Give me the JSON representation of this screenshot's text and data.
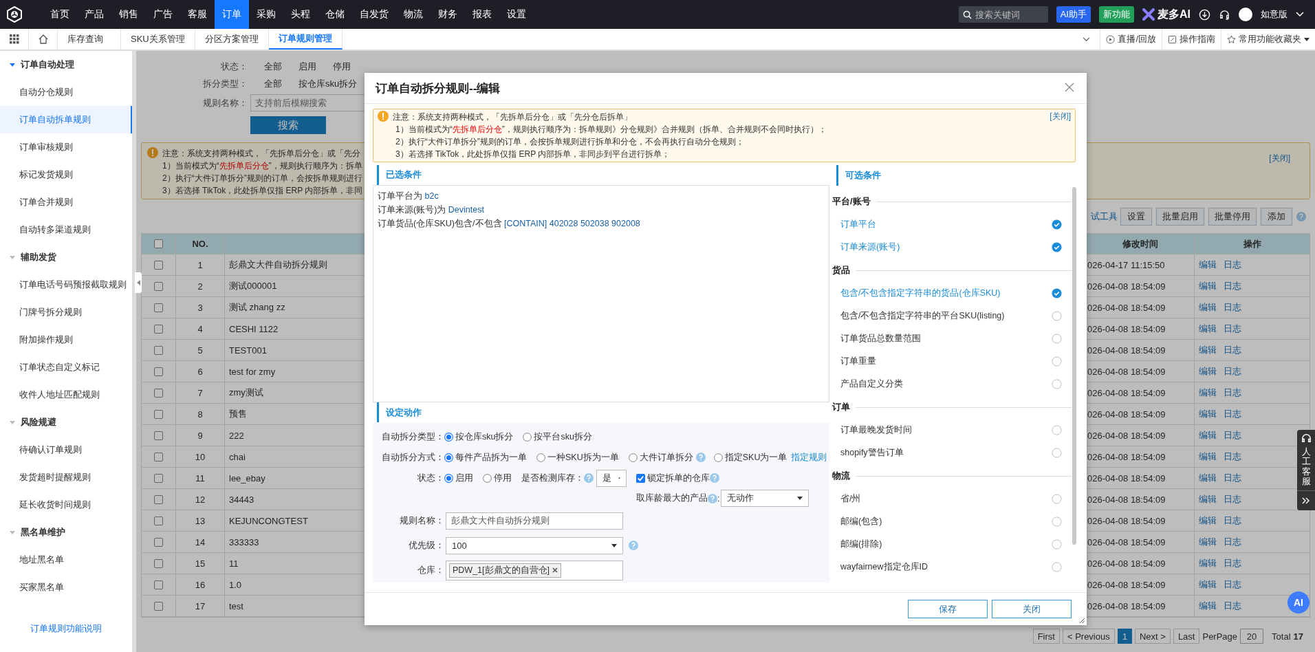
{
  "top_nav": {
    "menu": [
      {
        "label": "首页",
        "selected": false
      },
      {
        "label": "产品",
        "selected": false
      },
      {
        "label": "销售",
        "selected": false
      },
      {
        "label": "广告",
        "selected": false
      },
      {
        "label": "客服",
        "selected": false
      },
      {
        "label": "订单",
        "selected": true
      },
      {
        "label": "采购",
        "selected": false
      },
      {
        "label": "头程",
        "selected": false
      },
      {
        "label": "仓储",
        "selected": false
      },
      {
        "label": "自发货",
        "selected": false
      },
      {
        "label": "物流",
        "selected": false
      },
      {
        "label": "财务",
        "selected": false
      },
      {
        "label": "报表",
        "selected": false
      },
      {
        "label": "设置",
        "selected": false
      }
    ],
    "search": {
      "placeholder": "搜索关键词"
    },
    "ai_button": "AI助手",
    "new_button": "新功能",
    "brand": "麦多AI",
    "edition": "如意版"
  },
  "tab_bar": {
    "tabs": [
      {
        "label": "库存查询",
        "selected": false
      },
      {
        "label": "SKU关系管理",
        "selected": false
      },
      {
        "label": "分区方案管理",
        "selected": false
      },
      {
        "label": "订单规则管理",
        "selected": true
      }
    ],
    "links": [
      {
        "label": "直播/回放",
        "kind": "play"
      },
      {
        "label": "操作指南",
        "kind": "guide"
      },
      {
        "label": "常用功能收藏夹",
        "kind": "star"
      }
    ]
  },
  "sidebar": {
    "groups": [
      {
        "title": "订单自动处理",
        "items": [
          {
            "label": "自动分仓规则",
            "selected": false
          },
          {
            "label": "订单自动拆单规则",
            "selected": true
          },
          {
            "label": "订单审核规则",
            "selected": false
          },
          {
            "label": "标记发货规则",
            "selected": false
          },
          {
            "label": "订单合并规则",
            "selected": false
          },
          {
            "label": "自动转多渠道规则",
            "selected": false
          }
        ]
      },
      {
        "title": "辅助发货",
        "items": [
          {
            "label": "订单电话号码预报截取规则",
            "selected": false
          },
          {
            "label": "门牌号拆分规则",
            "selected": false
          },
          {
            "label": "附加操作规则",
            "selected": false
          },
          {
            "label": "订单状态自定义标记",
            "selected": false
          },
          {
            "label": "收件人地址匹配规则",
            "selected": false
          }
        ]
      },
      {
        "title": "风险规避",
        "items": [
          {
            "label": "待确认订单规则",
            "selected": false
          },
          {
            "label": "发货超时提醒规则",
            "selected": false
          },
          {
            "label": "延长收货时间规则",
            "selected": false
          }
        ]
      },
      {
        "title": "黑名单维护",
        "items": [
          {
            "label": "地址黑名单",
            "selected": false
          },
          {
            "label": "买家黑名单",
            "selected": false
          }
        ]
      }
    ],
    "footer_link": "订单规则功能说明"
  },
  "filters": {
    "rows": [
      {
        "label": "状态：",
        "options": [
          "全部",
          "启用",
          "停用"
        ]
      },
      {
        "label": "拆分类型：",
        "options": [
          "全部",
          "按仓库sku拆分"
        ]
      }
    ],
    "name_field": {
      "label": "规则名称：",
      "placeholder": "支持前后模糊搜索"
    },
    "search_button": "搜索"
  },
  "notice": {
    "lines": [
      "注意：系统支持两种模式，「先拆单后分仓」或「先分",
      "1）当前模式为“**先拆单后分仓**”，规则执行顺序为：拆单",
      "2）执行“大件订单拆分”规则的订单，会按拆单规则进行",
      "3）若选择 TikTok，此处拆单仅指 ERP 内部拆单，非同"
    ],
    "close": "[关闭]"
  },
  "toolbar": {
    "tool_link": "试工具",
    "buttons": [
      "设置",
      "批量启用",
      "批量停用",
      "添加"
    ]
  },
  "table": {
    "header": {
      "no": "NO.",
      "modified": "修改时间",
      "actions": "操作"
    },
    "all_checked": false,
    "rows": [
      {
        "no": "1",
        "name": "彭鼎文大件自动拆分规则",
        "modified": "026-04-17 11:15:50",
        "actions": [
          "编辑",
          "日志"
        ],
        "checked": false
      },
      {
        "no": "2",
        "name": "测试000001",
        "modified": "026-04-08 18:54:09",
        "actions": [
          "编辑",
          "日志"
        ],
        "checked": false
      },
      {
        "no": "3",
        "name": "测试 zhang zz",
        "modified": "026-04-08 18:54:09",
        "actions": [
          "编辑",
          "日志"
        ],
        "checked": false
      },
      {
        "no": "4",
        "name": "CESHI 1122",
        "modified": "026-04-08 18:54:09",
        "actions": [
          "编辑",
          "日志"
        ],
        "checked": false
      },
      {
        "no": "5",
        "name": "TEST001",
        "modified": "026-04-08 18:54:09",
        "actions": [
          "编辑",
          "日志"
        ],
        "checked": false
      },
      {
        "no": "6",
        "name": "test for zmy",
        "modified": "026-04-08 18:54:09",
        "actions": [
          "编辑",
          "日志"
        ],
        "checked": false
      },
      {
        "no": "7",
        "name": "zmy测试",
        "modified": "026-04-08 18:54:09",
        "actions": [
          "编辑",
          "日志"
        ],
        "checked": false
      },
      {
        "no": "8",
        "name": "预售",
        "modified": "026-04-08 18:54:09",
        "actions": [
          "编辑",
          "日志"
        ],
        "checked": false
      },
      {
        "no": "9",
        "name": "222",
        "modified": "026-04-08 18:54:09",
        "actions": [
          "编辑",
          "日志"
        ],
        "checked": false
      },
      {
        "no": "10",
        "name": "chai",
        "modified": "026-04-08 18:54:09",
        "actions": [
          "编辑",
          "日志"
        ],
        "checked": false
      },
      {
        "no": "11",
        "name": "lee_ebay",
        "modified": "026-04-08 18:54:09",
        "actions": [
          "编辑",
          "日志"
        ],
        "checked": false
      },
      {
        "no": "12",
        "name": "34443",
        "modified": "026-04-08 18:54:09",
        "actions": [
          "编辑",
          "日志"
        ],
        "checked": false
      },
      {
        "no": "13",
        "name": "KEJUNCONGTEST",
        "modified": "026-04-08 18:54:09",
        "actions": [
          "编辑",
          "日志"
        ],
        "checked": false
      },
      {
        "no": "14",
        "name": "333333",
        "modified": "026-04-08 18:54:09",
        "actions": [
          "编辑",
          "日志"
        ],
        "checked": false
      },
      {
        "no": "15",
        "name": "11",
        "modified": "026-04-08 18:54:09",
        "actions": [
          "编辑",
          "日志"
        ],
        "checked": false
      },
      {
        "no": "16",
        "name": "1.0",
        "modified": "026-04-08 18:54:09",
        "actions": [
          "编辑",
          "日志"
        ],
        "checked": false
      },
      {
        "no": "17",
        "name": "test",
        "modified": "026-04-08 18:54:09",
        "actions": [
          "编辑",
          "日志"
        ],
        "checked": false
      }
    ]
  },
  "pagination": {
    "first": "First",
    "previous": "< Previous",
    "pages": [
      {
        "label": "1",
        "selected": true
      }
    ],
    "next": "Next >",
    "last": "Last",
    "per_page_label": "PerPage",
    "per_page": "20",
    "total_label": "Total",
    "total": "17"
  },
  "modal": {
    "title": "订单自动拆分规则--编辑",
    "notice": {
      "lines": [
        "注意：系统支持两种模式，「先拆单后分仓」或「先分仓后拆单」",
        "1）当前模式为“**先拆单后分仓**”，规则执行顺序为：拆单规则》分仓规则》合并规则（拆单、合并规则不会同时执行）；",
        "2）执行“大件订单拆分”规则的订单，会按拆单规则进行拆单和分仓，不会再执行自动分仓规则；",
        "3）若选择 TikTok，此处拆单仅指 ERP 内部拆单，非同步到平台进行拆单；"
      ],
      "close": "[关闭]"
    },
    "selected_conditions": {
      "title": "已选条件",
      "lines": [
        {
          "label": "订单平台为",
          "value": "b2c"
        },
        {
          "label": "订单来源(账号)为",
          "value": "Devintest"
        },
        {
          "label": "订单货品(仓库SKU)包含/不包含",
          "value": "[CONTAIN] 402028 502038 902008"
        }
      ]
    },
    "available_conditions": {
      "title": "可选条件",
      "groups": [
        {
          "title": "平台/账号",
          "items": [
            {
              "label": "订单平台",
              "checked": true
            },
            {
              "label": "订单来源(账号)",
              "checked": true
            }
          ]
        },
        {
          "title": "货品",
          "items": [
            {
              "label": "包含/不包含指定字符串的货品(仓库SKU)",
              "checked": true
            },
            {
              "label": "包含/不包含指定字符串的平台SKU(listing)",
              "checked": false
            },
            {
              "label": "订单货品总数量范围",
              "checked": false
            },
            {
              "label": "订单重量",
              "checked": false
            },
            {
              "label": "产品自定义分类",
              "checked": false
            }
          ]
        },
        {
          "title": "订单",
          "items": [
            {
              "label": "订单最晚发货时间",
              "checked": false
            },
            {
              "label": "shopify警告订单",
              "checked": false
            }
          ]
        },
        {
          "title": "物流",
          "items": [
            {
              "label": "省/州",
              "checked": false
            },
            {
              "label": "邮编(包含)",
              "checked": false
            },
            {
              "label": "邮编(排除)",
              "checked": false
            },
            {
              "label": "wayfairnew指定仓库ID",
              "checked": false
            }
          ]
        }
      ]
    },
    "action": {
      "title": "设定动作",
      "split_type": {
        "label": "自动拆分类型：",
        "options": [
          {
            "label": "按仓库sku拆分",
            "selected": true
          },
          {
            "label": "按平台sku拆分",
            "selected": false
          }
        ]
      },
      "split_mode": {
        "label": "自动拆分方式：",
        "options": [
          {
            "label": "每件产品拆为一单",
            "selected": true,
            "help": false
          },
          {
            "label": "一种SKU拆为一单",
            "selected": false,
            "help": false
          },
          {
            "label": "大件订单拆分",
            "selected": false,
            "help": true
          },
          {
            "label": "指定SKU为一单",
            "selected": false,
            "help": false
          }
        ],
        "link": "指定规则"
      },
      "status": {
        "label": "状态：",
        "options": [
          {
            "label": "启用",
            "selected": true
          },
          {
            "label": "停用",
            "selected": false
          }
        ]
      },
      "check_stock": {
        "label": "是否检测库存：",
        "value": "是"
      },
      "lock_warehouse": {
        "label": "锁定拆单的仓库",
        "checked": true
      },
      "oldest_product": {
        "label": "取库龄最大的产品",
        "suffix": ":",
        "value": "无动作"
      },
      "rule_name": {
        "label": "规则名称：",
        "value": "彭鼎文大件自动拆分规则"
      },
      "priority": {
        "label": "优先级：",
        "value": "100"
      },
      "warehouse": {
        "label": "仓库：",
        "tags": [
          "PDW_1[彭鼎文的自营仓]"
        ]
      }
    },
    "buttons": [
      "保存",
      "关闭"
    ]
  },
  "float": {
    "service": "人工客服",
    "ai": "AI"
  }
}
